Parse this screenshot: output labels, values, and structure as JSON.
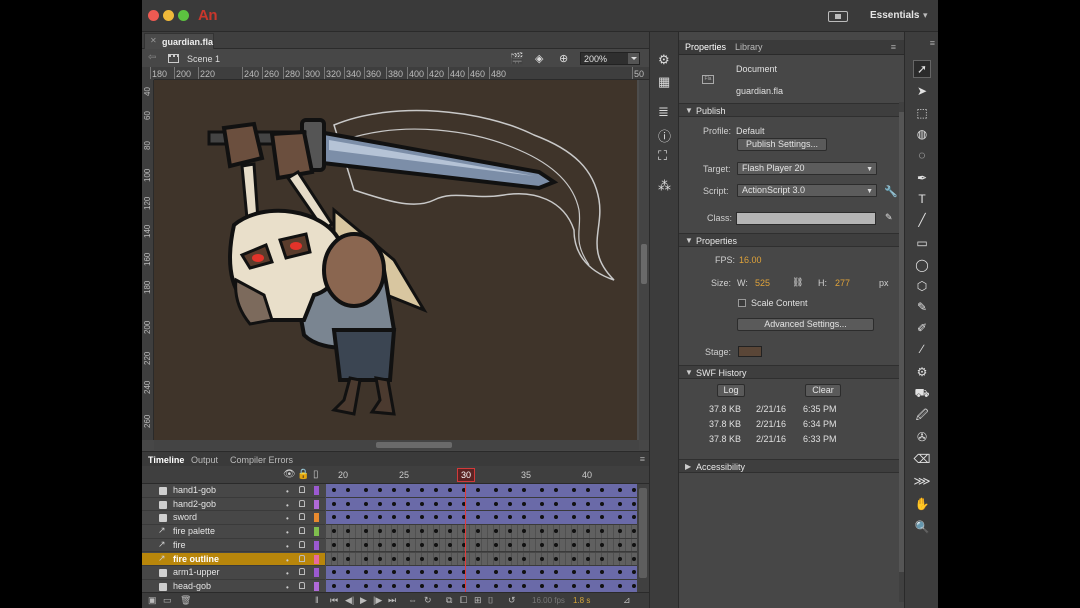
{
  "app": {
    "logo": "An",
    "workspace": "Essentials"
  },
  "document": {
    "tab_name": "guardian.fla",
    "scene": "Scene 1",
    "zoom": "200%"
  },
  "ruler": {
    "top": [
      "180",
      "200",
      "220",
      "240",
      "260",
      "280",
      "300",
      "320",
      "340",
      "360",
      "380",
      "400",
      "420",
      "440",
      "460",
      "480",
      "50"
    ],
    "left": [
      "40",
      "60",
      "80",
      "100",
      "120",
      "140",
      "160",
      "180",
      "200",
      "220",
      "240",
      "260"
    ]
  },
  "timeline": {
    "tabs": [
      "Timeline",
      "Output",
      "Compiler Errors"
    ],
    "frame_numbers": [
      "20",
      "25",
      "30",
      "35",
      "40"
    ],
    "current_frame": "30",
    "fps": "16.00 fps",
    "time": "1.8 s",
    "layers": [
      {
        "name": "hand1-gob",
        "color": "#9b59d0",
        "type": "normal"
      },
      {
        "name": "hand2-gob",
        "color": "#b06ad8",
        "type": "normal"
      },
      {
        "name": "sword",
        "color": "#e88a2e",
        "type": "normal"
      },
      {
        "name": "fire palette",
        "color": "#7fbf4d",
        "type": "guide"
      },
      {
        "name": "fire",
        "color": "#9b59d0",
        "type": "guide"
      },
      {
        "name": "fire outline",
        "color": "#e86aa0",
        "type": "guide",
        "selected": true
      },
      {
        "name": "arm1-upper",
        "color": "#9b59d0",
        "type": "normal"
      },
      {
        "name": "head-gob",
        "color": "#b06ad8",
        "type": "normal"
      }
    ]
  },
  "properties": {
    "tabs": [
      "Properties",
      "Library"
    ],
    "document_label": "Document",
    "document_name": "guardian.fla",
    "publish": {
      "section": "Publish",
      "profile_label": "Profile:",
      "profile_value": "Default",
      "settings_button": "Publish Settings...",
      "target_label": "Target:",
      "target_value": "Flash Player 20",
      "script_label": "Script:",
      "script_value": "ActionScript 3.0",
      "class_label": "Class:"
    },
    "props": {
      "section": "Properties",
      "fps_label": "FPS:",
      "fps_value": "16.00",
      "size_label": "Size:",
      "w_label": "W:",
      "w_value": "525",
      "h_label": "H:",
      "h_value": "277",
      "unit": "px",
      "scale_content": "Scale Content",
      "advanced_button": "Advanced Settings...",
      "stage_label": "Stage:",
      "stage_color": "#5a4637"
    },
    "swf": {
      "section": "SWF History",
      "log_button": "Log",
      "clear_button": "Clear",
      "rows": [
        {
          "size": "37.8 KB",
          "date": "2/21/16",
          "time": "6:35 PM"
        },
        {
          "size": "37.8 KB",
          "date": "2/21/16",
          "time": "6:34 PM"
        },
        {
          "size": "37.8 KB",
          "date": "2/21/16",
          "time": "6:33 PM"
        }
      ]
    },
    "accessibility": {
      "section": "Accessibility"
    }
  },
  "icons": {
    "tools": [
      "selection-tool-icon",
      "subselection-tool-icon",
      "free-transform-tool-icon",
      "3d-rotation-tool-icon",
      "lasso-tool-icon",
      "pen-tool-icon",
      "text-tool-icon",
      "line-tool-icon",
      "rectangle-tool-icon",
      "oval-tool-icon",
      "polystar-tool-icon",
      "pencil-tool-icon",
      "paint-brush-tool-icon",
      "brush-tool-icon",
      "bone-tool-icon",
      "paint-bucket-tool-icon",
      "ink-bottle-tool-icon",
      "eyedropper-tool-icon",
      "eraser-tool-icon",
      "width-tool-icon",
      "hand-tool-icon",
      "zoom-tool-icon"
    ]
  }
}
